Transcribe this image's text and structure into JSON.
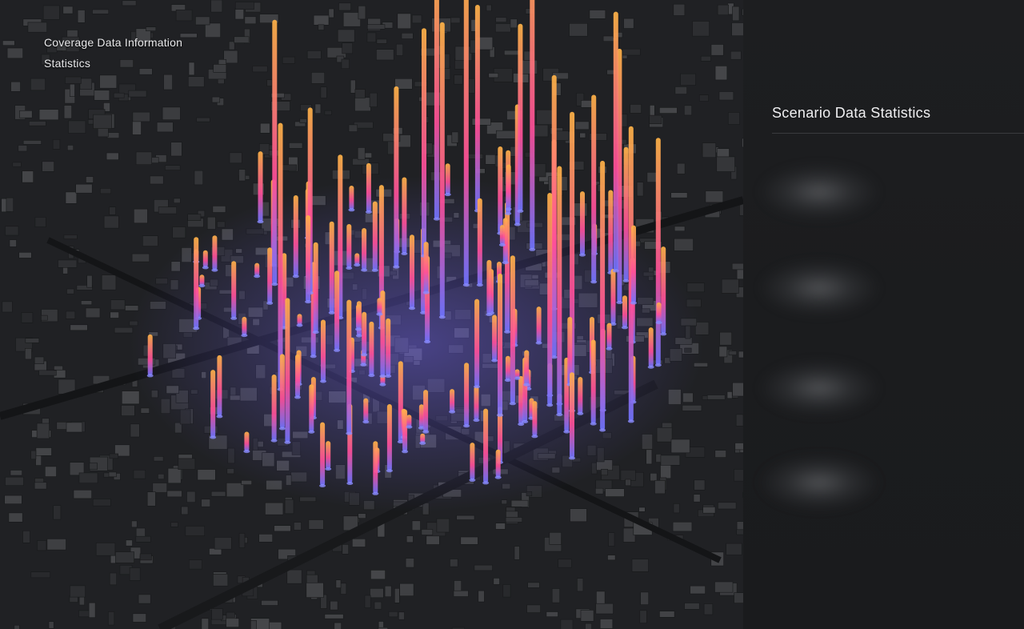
{
  "map": {
    "overlay_title_line1": "Coverage Data Information",
    "overlay_title_line2": "Statistics",
    "building_color": "#3a3b3e",
    "background_color": "#222326",
    "bar_gradient": [
      "#6e73ff",
      "#ff4f9a",
      "#ffb347"
    ]
  },
  "panel": {
    "title": "Scenario Data Statistics"
  }
}
